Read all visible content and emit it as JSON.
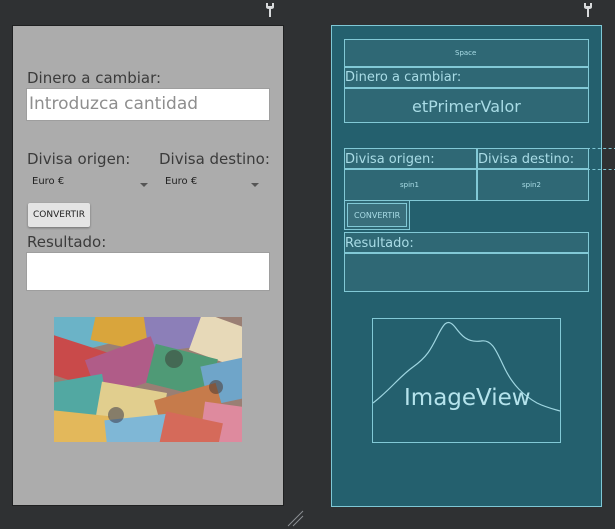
{
  "design": {
    "amount_label": "Dinero a cambiar:",
    "amount_hint": "Introduzca cantidad",
    "source_label": "Divisa origen:",
    "target_label": "Divisa destino:",
    "source_value": "Euro €",
    "target_value": "Euro €",
    "convert_button": "CONVERTIR",
    "result_label": "Resultado:",
    "result_value": ""
  },
  "blueprint": {
    "space_label": "Space",
    "amount_label": "Dinero a cambiar:",
    "amount_id": "etPrimerValor",
    "source_label": "Divisa origen:",
    "target_label": "Divisa destino:",
    "spinner1_id": "spin1",
    "spinner2_id": "spin2",
    "convert_button": "CONVERTIR",
    "result_label": "Resultado:",
    "image_label": "ImageView"
  },
  "icons": {
    "left_corner": "wrench-icon",
    "right_corner": "wrench-icon",
    "resize": "resize-handle-icon"
  },
  "colors": {
    "canvas_bg": "#2f3133",
    "design_bg": "#acacac",
    "blueprint_bg": "#24606e",
    "blueprint_line": "#82c9d6"
  }
}
